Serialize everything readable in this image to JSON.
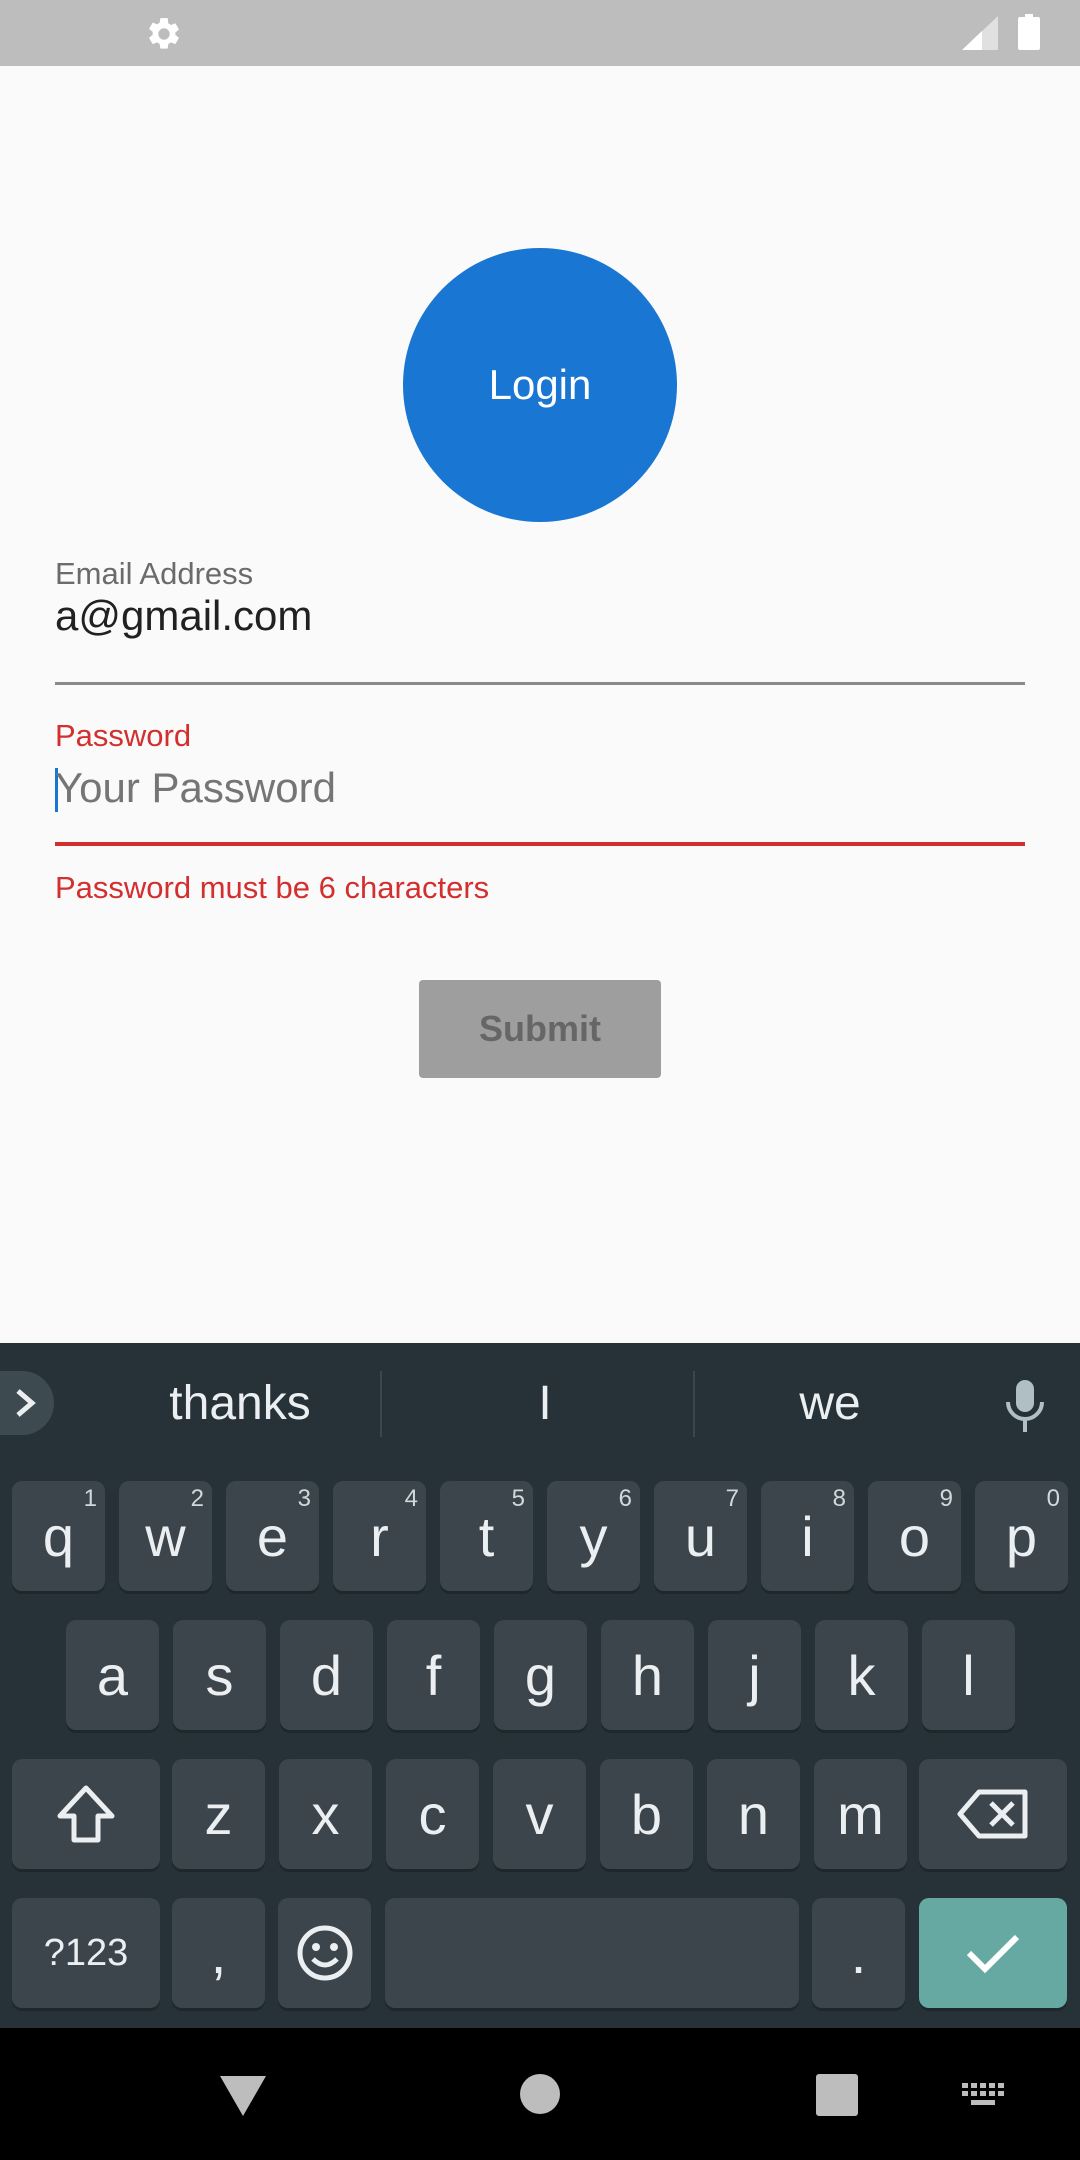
{
  "status_bar": {
    "settings_icon": "gear-icon",
    "signal_icon": "cell-signal-icon",
    "battery_icon": "battery-icon"
  },
  "header": {
    "login_label": "Login",
    "accent_color": "#1976d2"
  },
  "form": {
    "email": {
      "label": "Email Address",
      "value": "a@gmail.com"
    },
    "password": {
      "label": "Password",
      "placeholder": "Your Password",
      "error": "Password must be 6 characters",
      "error_color": "#d32f2f"
    },
    "submit_label": "Submit"
  },
  "keyboard": {
    "suggestions": [
      "thanks",
      "I",
      "we"
    ],
    "row1": [
      {
        "k": "q",
        "h": "1"
      },
      {
        "k": "w",
        "h": "2"
      },
      {
        "k": "e",
        "h": "3"
      },
      {
        "k": "r",
        "h": "4"
      },
      {
        "k": "t",
        "h": "5"
      },
      {
        "k": "y",
        "h": "6"
      },
      {
        "k": "u",
        "h": "7"
      },
      {
        "k": "i",
        "h": "8"
      },
      {
        "k": "o",
        "h": "9"
      },
      {
        "k": "p",
        "h": "0"
      }
    ],
    "row2": [
      "a",
      "s",
      "d",
      "f",
      "g",
      "h",
      "j",
      "k",
      "l"
    ],
    "row3": [
      "z",
      "x",
      "c",
      "v",
      "b",
      "n",
      "m"
    ],
    "symbols_label": "?123",
    "comma": ",",
    "period": ".",
    "enter_color": "#66a9a3"
  },
  "nav_bar": {
    "back_icon": "back-triangle-icon",
    "home_icon": "home-circle-icon",
    "recents_icon": "recents-square-icon",
    "keyboard_icon": "keyboard-icon"
  }
}
